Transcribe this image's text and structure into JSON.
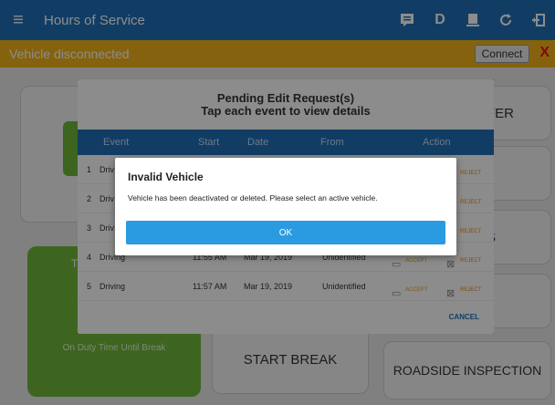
{
  "topbar": {
    "title": "Hours of Service",
    "icons": [
      "menu-icon",
      "messages-icon",
      "d-icon",
      "inspection-icon",
      "refresh-icon",
      "logout-icon"
    ],
    "d_label": "D"
  },
  "status_bar": {
    "text": "Vehicle disconnected",
    "connect_label": "Connect",
    "close_label": "X"
  },
  "background": {
    "transfer_label": "FER",
    "on_duty_label": "On Duty Time Until Break",
    "t_label": "T",
    "s_label": "S",
    "start_break_label": "START BREAK",
    "roadside_label": "ROADSIDE INSPECTION"
  },
  "pending_modal": {
    "title": "Pending Edit Request(s)",
    "subtitle": "Tap each event to view details",
    "columns": [
      "Event",
      "Start",
      "Date",
      "From",
      "Action"
    ],
    "rows": [
      {
        "num": "1",
        "event": "Driv",
        "start": "",
        "date": "",
        "from": ""
      },
      {
        "num": "2",
        "event": "Driv",
        "start": "",
        "date": "",
        "from": ""
      },
      {
        "num": "3",
        "event": "Driv",
        "start": "",
        "date": "",
        "from": ""
      },
      {
        "num": "4",
        "event": "Driving",
        "start": "11:55 AM",
        "date": "Mar 19, 2019",
        "from": "Unidentified"
      },
      {
        "num": "5",
        "event": "Driving",
        "start": "11:57 AM",
        "date": "Mar 19, 2019",
        "from": "Unidentified"
      }
    ],
    "accept_label": "ACCEPT",
    "reject_label": "REJECT",
    "cancel_label": "CANCEL"
  },
  "dialog": {
    "title": "Invalid Vehicle",
    "message": "Vehicle has been deactivated or deleted. Please select an active vehicle.",
    "ok_label": "OK"
  },
  "colors": {
    "primary": "#1f6fb8",
    "warning": "#f3b41a",
    "green": "#6fb93a",
    "button": "#2a9be0"
  }
}
